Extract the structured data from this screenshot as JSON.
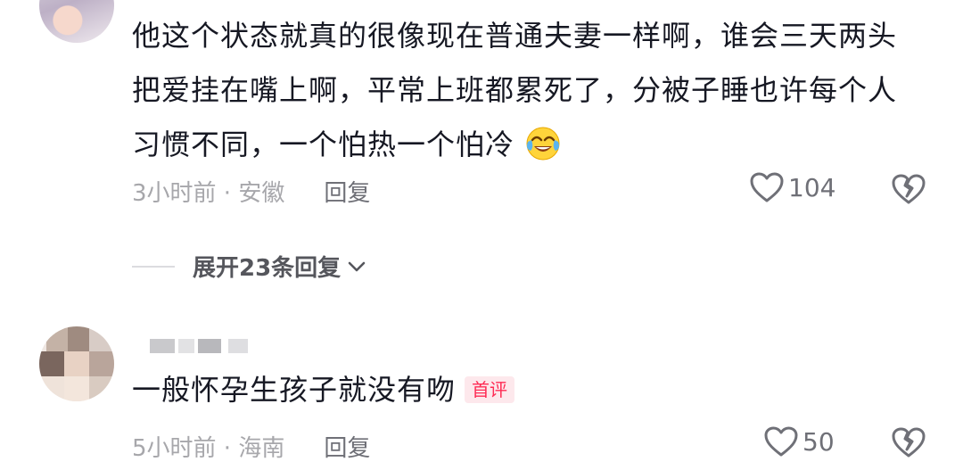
{
  "comments": [
    {
      "text": "他这个状态就真的很像现在普通夫妻一样啊，谁会三天两头把爱挂在嘴上啊，平常上班都累死了，分被子睡也许每个人习惯不同，一个怕热一个怕冷",
      "emoji": "crying-laughing-emoji",
      "time_location": "3小时前 · 安徽",
      "reply_label": "回复",
      "likes": "104"
    },
    {
      "text": "一般怀孕生孩子就没有吻",
      "badge": "首评",
      "time_location": "5小时前 · 海南",
      "reply_label": "回复",
      "likes": "50"
    }
  ],
  "expand_replies_label": "展开23条回复",
  "colors": {
    "text": "#161823",
    "meta": "#a7a7ab",
    "badge": "#fe2c55",
    "badge_bg": "#fde8ec"
  }
}
